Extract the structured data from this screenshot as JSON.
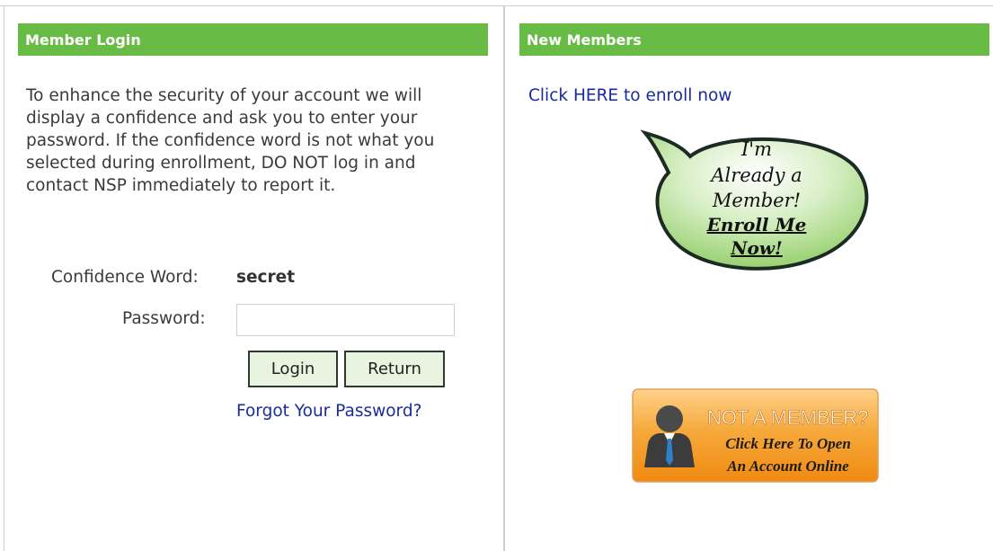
{
  "login_panel": {
    "header": "Member Login",
    "intro": "To enhance the security of your account we will display a confidence and ask you to enter your password. If the confidence word is not what you selected during enrollment, DO NOT log in and contact NSP immediately to report it.",
    "confidence_label": "Confidence Word:",
    "confidence_value": "secret",
    "password_label": "Password:",
    "password_value": "",
    "login_button": "Login",
    "return_button": "Return",
    "forgot_link": "Forgot Your Password?"
  },
  "new_members_panel": {
    "header": "New Members",
    "enroll_link": "Click HERE to enroll now",
    "bubble": {
      "line1": "I'm",
      "line2": "Already a",
      "line3": "Member!",
      "line4": "Enroll Me",
      "line5": "Now!"
    },
    "banner": {
      "title": "NOT A MEMBER?",
      "line1": "Click Here To Open",
      "line2": "An Account Online"
    }
  },
  "colors": {
    "header_green": "#68bc45",
    "link_blue": "#1a2b9a",
    "banner_orange": "#f39a1c"
  }
}
